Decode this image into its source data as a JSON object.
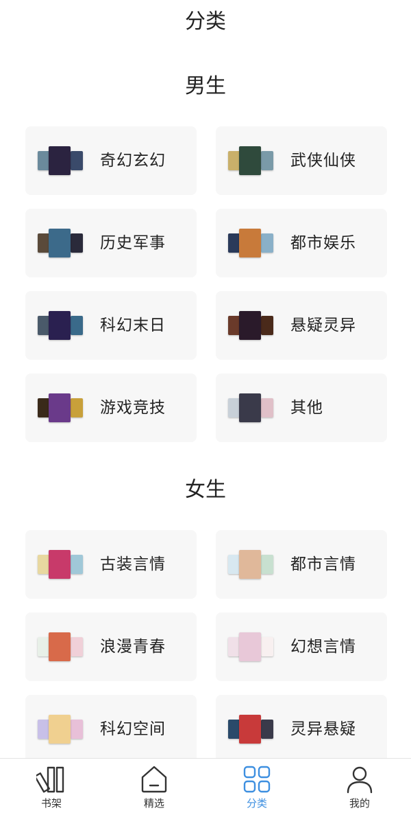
{
  "page_title": "分类",
  "colors": {
    "accent": "#3d8fe0",
    "card_bg": "#f7f7f7",
    "text": "#222222"
  },
  "sections": [
    {
      "title": "男生",
      "categories": [
        {
          "label": "奇幻玄幻",
          "covers": [
            "#6b8a9c",
            "#2b2340",
            "#3a4a6a"
          ]
        },
        {
          "label": "武侠仙侠",
          "covers": [
            "#c9b06a",
            "#2f4a3c",
            "#7a9aa8"
          ]
        },
        {
          "label": "历史军事",
          "covers": [
            "#5a4a3a",
            "#3c6a8a",
            "#2a2a3a"
          ]
        },
        {
          "label": "都市娱乐",
          "covers": [
            "#2a3a5a",
            "#c87a3a",
            "#8ab0c8"
          ]
        },
        {
          "label": "科幻末日",
          "covers": [
            "#4a5a6a",
            "#2a2050",
            "#3a6a8a"
          ]
        },
        {
          "label": "悬疑灵异",
          "covers": [
            "#6a3a2a",
            "#2a1a2a",
            "#4a2a1a"
          ]
        },
        {
          "label": "游戏竞技",
          "covers": [
            "#3a2a1a",
            "#6a3a8a",
            "#c8a03a"
          ]
        },
        {
          "label": "其他",
          "covers": [
            "#c8d0d8",
            "#3a3a4a",
            "#e0c0c8"
          ]
        }
      ]
    },
    {
      "title": "女生",
      "categories": [
        {
          "label": "古装言情",
          "covers": [
            "#e8d8a0",
            "#c83a6a",
            "#a0c8d8"
          ]
        },
        {
          "label": "都市言情",
          "covers": [
            "#d8e8f0",
            "#e0b89a",
            "#c8e0d0"
          ]
        },
        {
          "label": "浪漫青春",
          "covers": [
            "#e8f0e8",
            "#d86a4a",
            "#f0d0d8"
          ]
        },
        {
          "label": "幻想言情",
          "covers": [
            "#f0e0e8",
            "#e8c8d8",
            "#f8f0f0"
          ]
        },
        {
          "label": "科幻空间",
          "covers": [
            "#c8c0e8",
            "#f0d090",
            "#e8c0d8"
          ]
        },
        {
          "label": "灵异悬疑",
          "covers": [
            "#2a4a6a",
            "#c83a3a",
            "#3a3a4a"
          ]
        }
      ]
    }
  ],
  "tabbar": [
    {
      "label": "书架",
      "icon": "bookshelf-icon",
      "active": false
    },
    {
      "label": "精选",
      "icon": "home-icon",
      "active": false
    },
    {
      "label": "分类",
      "icon": "grid-icon",
      "active": true
    },
    {
      "label": "我的",
      "icon": "user-icon",
      "active": false
    }
  ]
}
